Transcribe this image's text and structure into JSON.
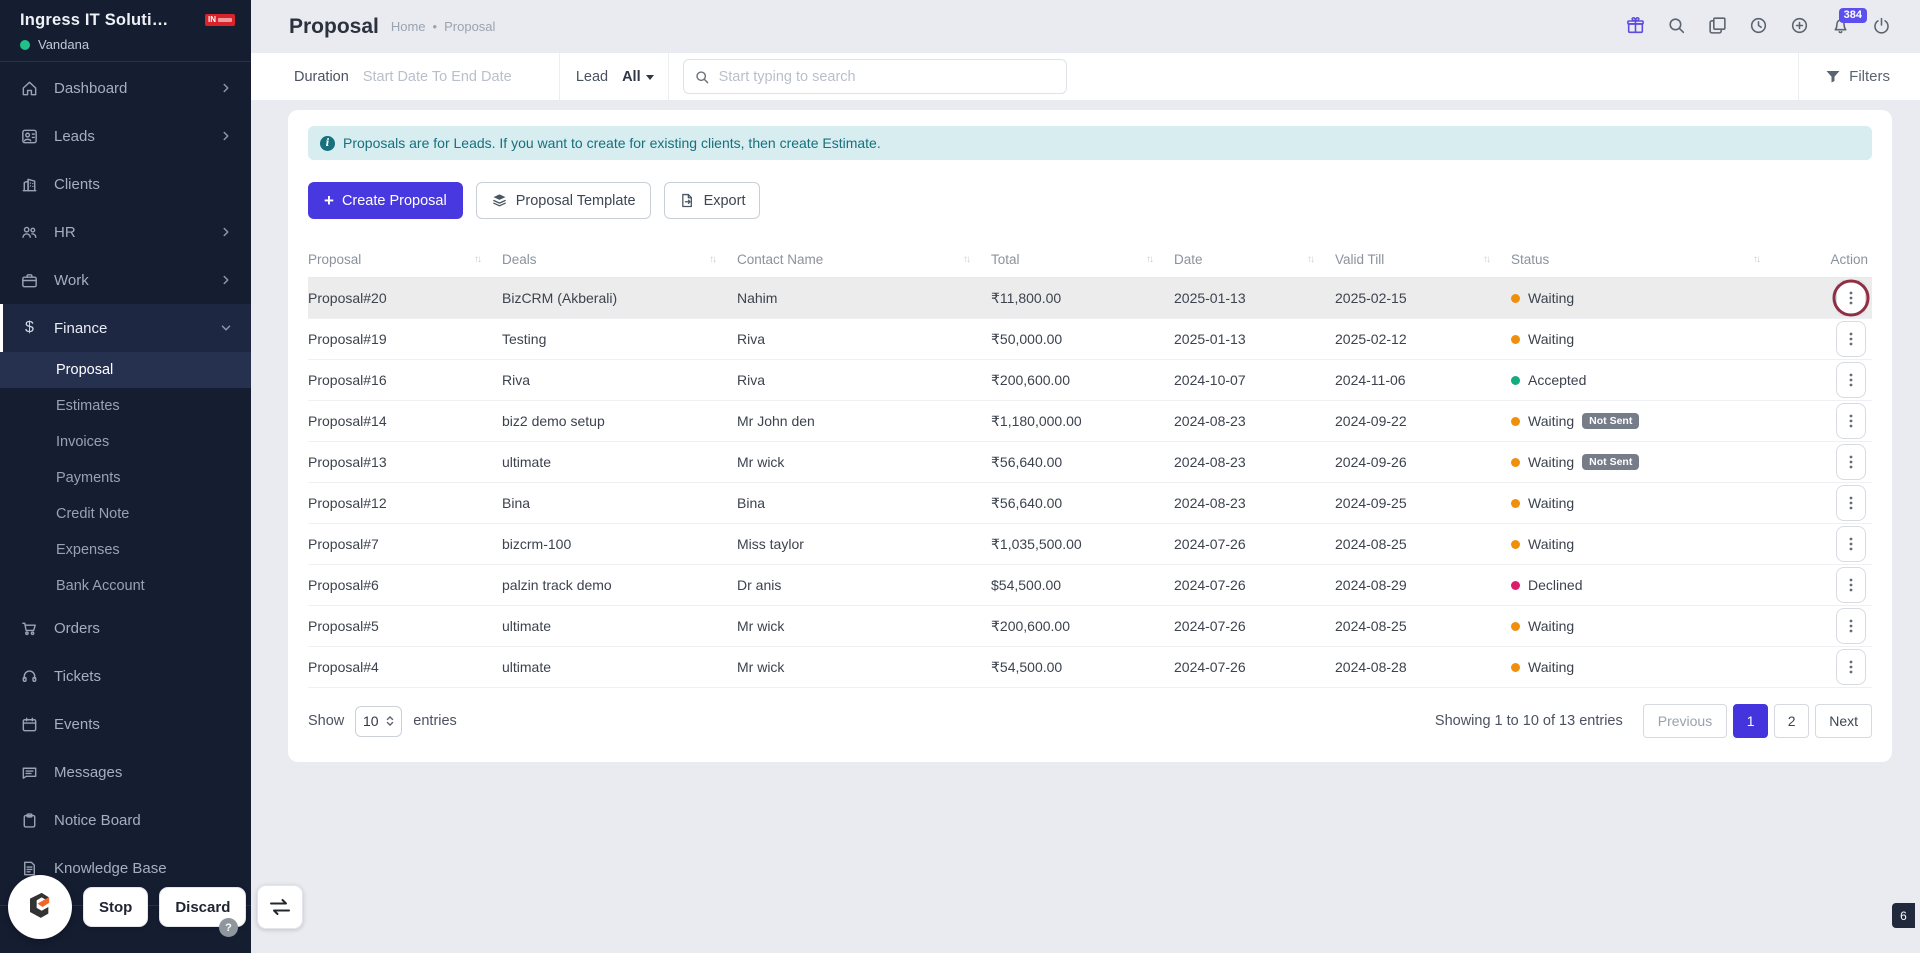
{
  "sidebar": {
    "company": "Ingress IT Soluti…",
    "user": "Vandana",
    "brand": "IN",
    "items": [
      {
        "label": "Dashboard"
      },
      {
        "label": "Leads"
      },
      {
        "label": "Clients"
      },
      {
        "label": "HR"
      },
      {
        "label": "Work"
      },
      {
        "label": "Finance"
      },
      {
        "label": "Orders"
      },
      {
        "label": "Tickets"
      },
      {
        "label": "Events"
      },
      {
        "label": "Messages"
      },
      {
        "label": "Notice Board"
      },
      {
        "label": "Knowledge Base"
      }
    ],
    "finance_children": [
      {
        "label": "Proposal",
        "active": true
      },
      {
        "label": "Estimates"
      },
      {
        "label": "Invoices"
      },
      {
        "label": "Payments"
      },
      {
        "label": "Credit Note"
      },
      {
        "label": "Expenses"
      },
      {
        "label": "Bank Account"
      }
    ]
  },
  "header": {
    "title": "Proposal",
    "breadcrumb_home": "Home",
    "breadcrumb_sep": "•",
    "breadcrumb_current": "Proposal",
    "notification_count": "384"
  },
  "filters": {
    "duration_label": "Duration",
    "duration_placeholder": "Start Date To End Date",
    "lead_label": "Lead",
    "lead_value": "All",
    "search_placeholder": "Start typing to search",
    "filters_label": "Filters"
  },
  "banner": {
    "text": "Proposals are for Leads. If you want to create for existing clients, then create Estimate."
  },
  "actions": {
    "create": "Create Proposal",
    "template": "Proposal Template",
    "export": "Export"
  },
  "table": {
    "columns": [
      "Proposal",
      "Deals",
      "Contact Name",
      "Total",
      "Date",
      "Valid Till",
      "Status",
      "Action"
    ],
    "not_sent_label": "Not Sent",
    "rows": [
      {
        "proposal": "Proposal#20",
        "deal": "BizCRM (Akberali)",
        "contact": "Nahim",
        "total": "₹11,800.00",
        "date": "2025-01-13",
        "valid": "2025-02-15",
        "status": "Waiting",
        "not_sent": false,
        "highlight": true,
        "annotated": true
      },
      {
        "proposal": "Proposal#19",
        "deal": "Testing",
        "contact": "Riva",
        "total": "₹50,000.00",
        "date": "2025-01-13",
        "valid": "2025-02-12",
        "status": "Waiting",
        "not_sent": false
      },
      {
        "proposal": "Proposal#16",
        "deal": "Riva",
        "contact": "Riva",
        "total": "₹200,600.00",
        "date": "2024-10-07",
        "valid": "2024-11-06",
        "status": "Accepted",
        "not_sent": false
      },
      {
        "proposal": "Proposal#14",
        "deal": "biz2 demo setup",
        "contact": "Mr John den",
        "total": "₹1,180,000.00",
        "date": "2024-08-23",
        "valid": "2024-09-22",
        "status": "Waiting",
        "not_sent": true
      },
      {
        "proposal": "Proposal#13",
        "deal": "ultimate",
        "contact": "Mr wick",
        "total": "₹56,640.00",
        "date": "2024-08-23",
        "valid": "2024-09-26",
        "status": "Waiting",
        "not_sent": true
      },
      {
        "proposal": "Proposal#12",
        "deal": "Bina",
        "contact": "Bina",
        "total": "₹56,640.00",
        "date": "2024-08-23",
        "valid": "2024-09-25",
        "status": "Waiting",
        "not_sent": false
      },
      {
        "proposal": "Proposal#7",
        "deal": "bizcrm-100",
        "contact": "Miss taylor",
        "total": "₹1,035,500.00",
        "date": "2024-07-26",
        "valid": "2024-08-25",
        "status": "Waiting",
        "not_sent": false
      },
      {
        "proposal": "Proposal#6",
        "deal": "palzin track demo",
        "contact": "Dr anis",
        "total": "$54,500.00",
        "date": "2024-07-26",
        "valid": "2024-08-29",
        "status": "Declined",
        "not_sent": false
      },
      {
        "proposal": "Proposal#5",
        "deal": "ultimate",
        "contact": "Mr wick",
        "total": "₹200,600.00",
        "date": "2024-07-26",
        "valid": "2024-08-25",
        "status": "Waiting",
        "not_sent": false
      },
      {
        "proposal": "Proposal#4",
        "deal": "ultimate",
        "contact": "Mr wick",
        "total": "₹54,500.00",
        "date": "2024-07-26",
        "valid": "2024-08-28",
        "status": "Waiting",
        "not_sent": false
      }
    ]
  },
  "footer": {
    "show": "Show",
    "size": "10",
    "entries": "entries",
    "summary": "Showing 1 to 10 of 13 entries",
    "prev": "Previous",
    "page1": "1",
    "page2": "2",
    "next": "Next"
  },
  "overlay": {
    "stop": "Stop",
    "discard": "Discard",
    "help": "?",
    "page_badge": "6"
  },
  "colors": {
    "accent": "#4838df",
    "sidebar_bg": "#151d31",
    "banner_bg": "#d7edf0",
    "banner_text": "#17707c",
    "badge": "#5b50ed",
    "annotation_ring": "#8e2f44",
    "status": {
      "Waiting": "#F18F0D",
      "Accepted": "#12AD7E",
      "Declined": "#E01A6B"
    }
  }
}
